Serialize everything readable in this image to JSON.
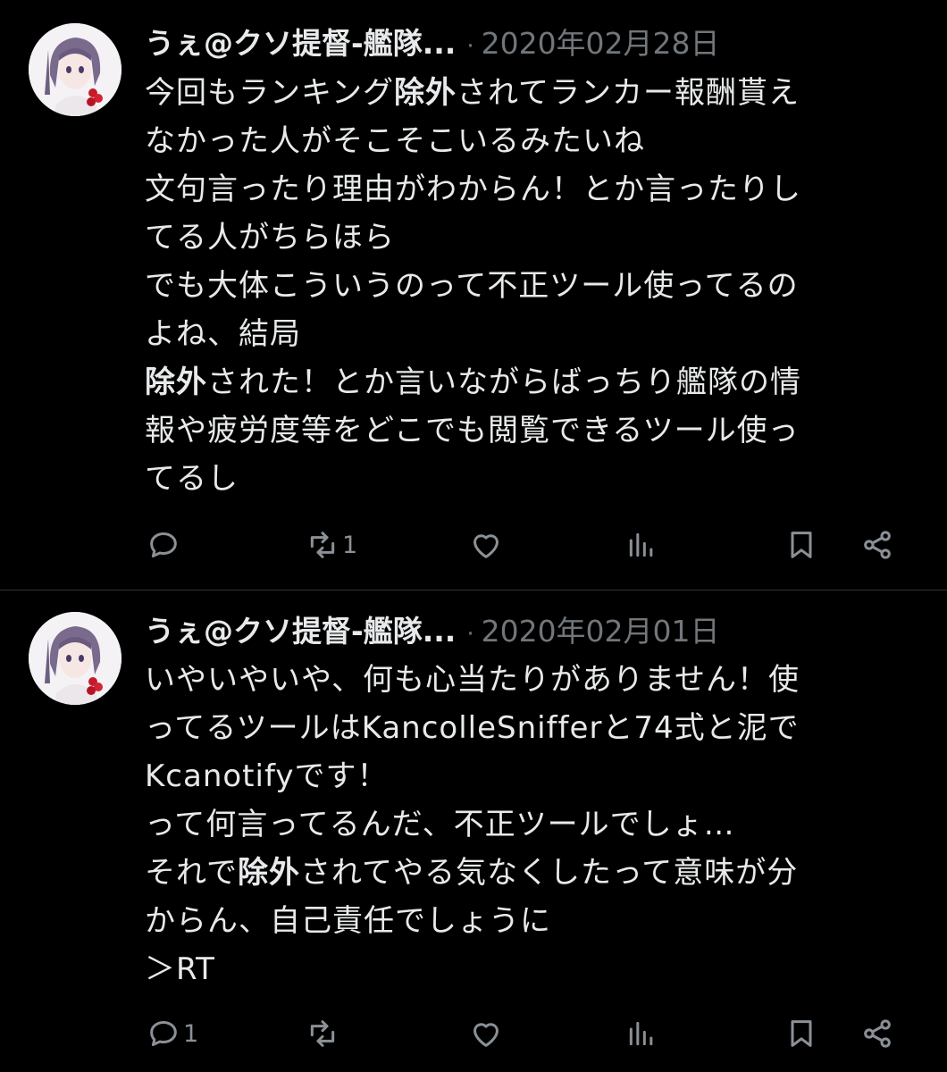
{
  "tweets": [
    {
      "author": "うぇ@クソ提督-艦隊...",
      "separator": "·",
      "date": "2020年02月28日",
      "lines": [
        [
          {
            "t": "今回もランキング"
          },
          {
            "t": "除外",
            "b": true
          },
          {
            "t": "されてランカー報酬貰え"
          }
        ],
        [
          {
            "t": "なかった人がそこそこいるみたいね"
          }
        ],
        [
          {
            "t": "文句言ったり理由がわからん！とか言ったりし"
          }
        ],
        [
          {
            "t": "てる人がちらほら"
          }
        ],
        [
          {
            "t": "でも大体こういうのって不正ツール使ってるの"
          }
        ],
        [
          {
            "t": "よね、結局"
          }
        ],
        [
          {
            "t": "除外",
            "b": true
          },
          {
            "t": "された！とか言いながらばっちり艦隊の情"
          }
        ],
        [
          {
            "t": "報や疲労度等をどこでも閲覧できるツール使っ"
          }
        ],
        [
          {
            "t": "てるし"
          }
        ]
      ],
      "counts": {
        "reply": "",
        "retweet": "1",
        "like": "",
        "views": ""
      }
    },
    {
      "author": "うぇ@クソ提督-艦隊...",
      "separator": "·",
      "date": "2020年02月01日",
      "lines": [
        [
          {
            "t": "いやいやいや、何も心当たりがありません！使"
          }
        ],
        [
          {
            "t": "ってるツールはKancolleSnifferと74式と泥で"
          }
        ],
        [
          {
            "t": "Kcanotifyです！"
          }
        ],
        [
          {
            "t": "って何言ってるんだ、不正ツールでしょ…"
          }
        ],
        [
          {
            "t": "それで"
          },
          {
            "t": "除外",
            "b": true
          },
          {
            "t": "されてやる気なくしたって意味が分"
          }
        ],
        [
          {
            "t": "からん、自己責任でしょうに"
          }
        ],
        [
          {
            "t": "＞RT"
          }
        ]
      ],
      "counts": {
        "reply": "1",
        "retweet": "",
        "like": "",
        "views": ""
      }
    }
  ],
  "colors": {
    "background": "#000000",
    "text": "#e7e9ea",
    "muted": "#71767b",
    "icon": "#8b9096",
    "divider": "#2f3336"
  },
  "icons": [
    "reply-icon",
    "retweet-icon",
    "like-icon",
    "views-icon",
    "bookmark-icon",
    "share-icon"
  ]
}
